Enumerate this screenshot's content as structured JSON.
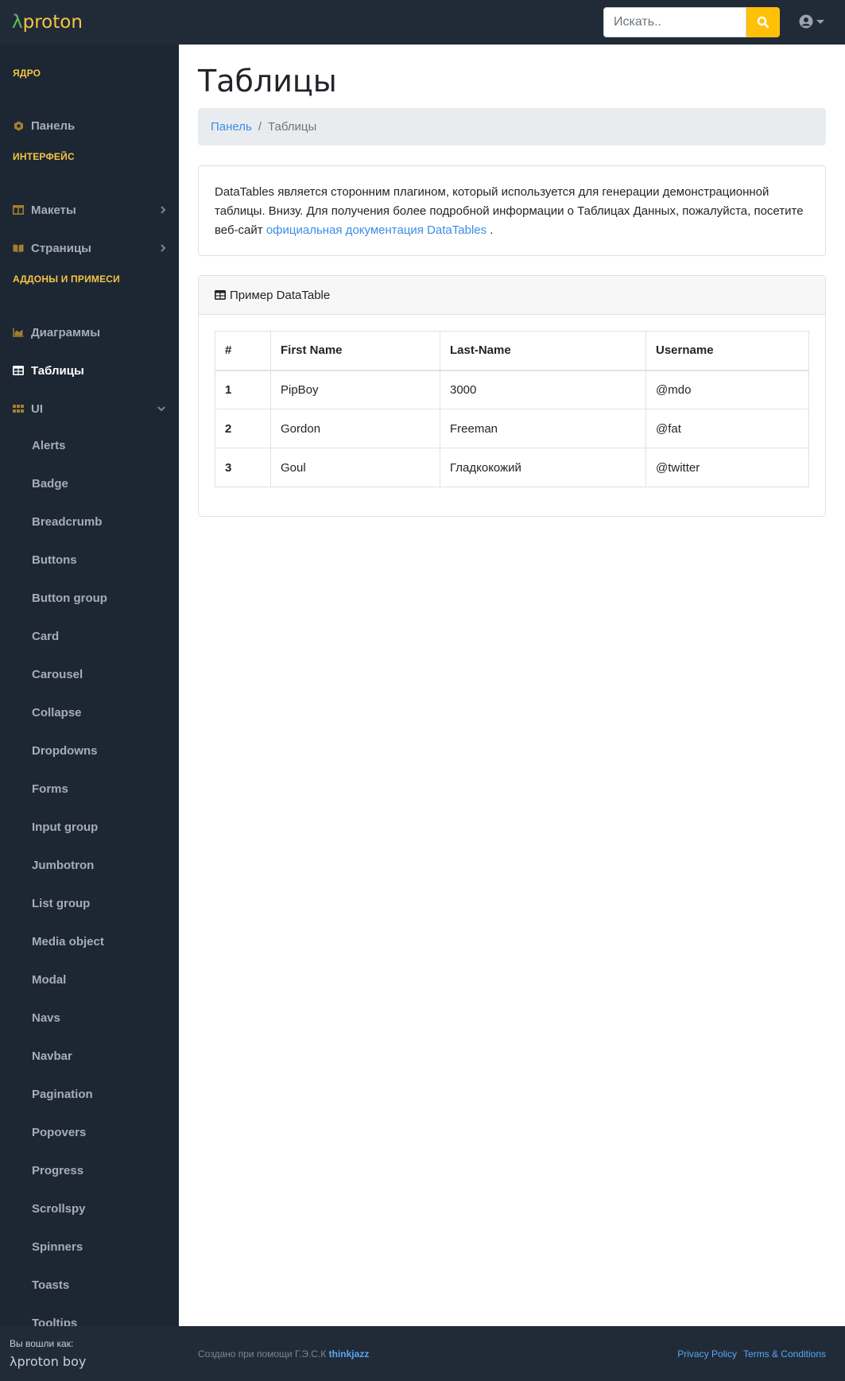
{
  "app": {
    "brand_lambda": "λ",
    "brand_name": "proton"
  },
  "topbar": {
    "search_placeholder": "Искать..",
    "search_icon": "search-icon",
    "user_icon": "user-circle-icon"
  },
  "sidebar": {
    "sections": {
      "core": "ЯДРО",
      "interface": "ИНТЕРФЕЙС",
      "addons": "АДДОНЫ И ПРИМЕСИ"
    },
    "core_items": [
      {
        "label": "Панель",
        "icon": "tachometer-icon"
      }
    ],
    "interface_items": [
      {
        "label": "Макеты",
        "icon": "columns-icon"
      },
      {
        "label": "Страницы",
        "icon": "book-icon"
      }
    ],
    "addon_items": [
      {
        "label": "Диаграммы",
        "icon": "area-chart-icon"
      },
      {
        "label": "Таблицы",
        "icon": "table-icon",
        "active": true
      },
      {
        "label": "UI",
        "icon": "th-icon"
      }
    ],
    "ui_subitems": [
      "Alerts",
      "Badge",
      "Breadcrumb",
      "Buttons",
      "Button group",
      "Card",
      "Carousel",
      "Collapse",
      "Dropdowns",
      "Forms",
      "Input group",
      "Jumbotron",
      "List group",
      "Media object",
      "Modal",
      "Navs",
      "Navbar",
      "Pagination",
      "Popovers",
      "Progress",
      "Scrollspy",
      "Spinners",
      "Toasts",
      "Tooltips"
    ]
  },
  "main": {
    "title": "Таблицы",
    "breadcrumb": {
      "home": "Панель",
      "separator": "/",
      "current": "Таблицы"
    },
    "info": {
      "text": "DataTables является сторонним плагином, который используется для генерации демонстрационной таблицы. Внизу. Для получения более подробной информации о Таблицах Данных, пожалуйста, посетите веб-сайт ",
      "link": "официальная документация DataTables",
      "end": " ."
    },
    "table_card": {
      "title": "Пример DataTable",
      "columns": [
        "#",
        "First Name",
        "Last-Name",
        "Username"
      ],
      "rows": [
        [
          "1",
          "PipBoy",
          "3000",
          "@mdo"
        ],
        [
          "2",
          "Gordon",
          "Freeman",
          "@fat"
        ],
        [
          "3",
          "Goul",
          "Гладкокожий",
          "@twitter"
        ]
      ]
    }
  },
  "footer": {
    "logged_as": "Вы вошли как:",
    "user": "λproton boy",
    "credit_text": "Создано при помощи Г.Э.С.К",
    "credit_link": "thinkjazz",
    "privacy": "Privacy Policy",
    "terms": "Terms & Conditions"
  },
  "colors": {
    "navbar": "#212b38",
    "sidebar": "#1d2633",
    "accent": "#f5c542",
    "link": "#3a8ee6",
    "search_button": "#ffc107"
  }
}
